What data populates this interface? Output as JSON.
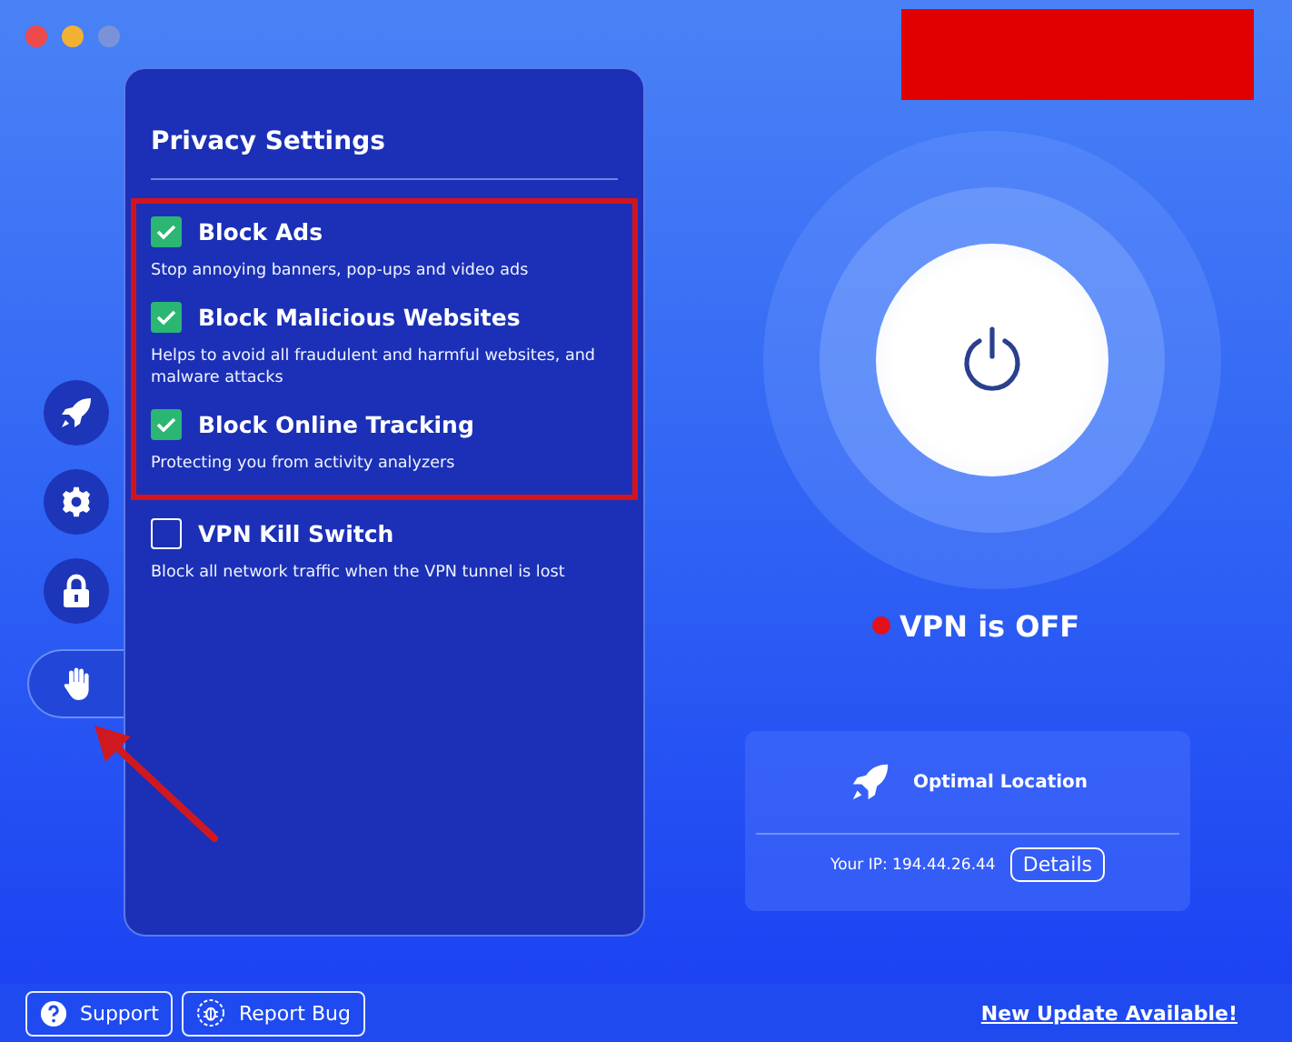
{
  "sidebar": {
    "items": [
      {
        "kind": "rocket",
        "selected": false
      },
      {
        "kind": "gear",
        "selected": false
      },
      {
        "kind": "lock",
        "selected": false
      },
      {
        "kind": "hand",
        "selected": true
      }
    ]
  },
  "panel": {
    "title": "Privacy Settings",
    "options": [
      {
        "label": "Block Ads",
        "description": "Stop annoying banners, pop-ups and video ads",
        "checked": true,
        "highlighted": true
      },
      {
        "label": "Block Malicious Websites",
        "description": "Helps to avoid all fraudulent and harmful websites, and malware attacks",
        "checked": true,
        "highlighted": true
      },
      {
        "label": "Block Online Tracking",
        "description": "Protecting you from activity analyzers",
        "checked": true,
        "highlighted": true
      },
      {
        "label": "VPN Kill Switch",
        "description": "Block all network traffic when the VPN tunnel is lost",
        "checked": false,
        "highlighted": false
      }
    ]
  },
  "status": {
    "text": "VPN is OFF",
    "connected": false
  },
  "location": {
    "label": "Optimal Location",
    "ip": "Your IP: 194.44.26.44",
    "details_button": "Details"
  },
  "footer": {
    "buttons": [
      {
        "kind": "support",
        "label": "Support"
      },
      {
        "kind": "bug",
        "label": "Report Bug"
      }
    ],
    "update_link": "New Update Available!"
  }
}
